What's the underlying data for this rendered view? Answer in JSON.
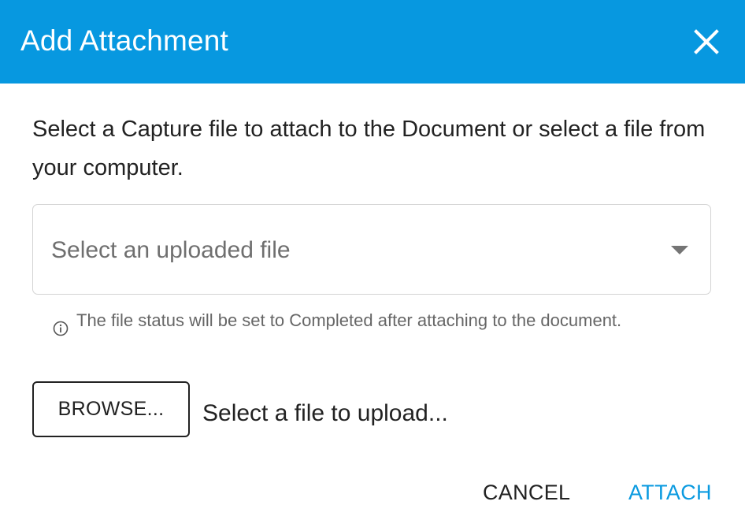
{
  "dialog": {
    "title": "Add Attachment",
    "close_icon": "close-icon"
  },
  "content": {
    "description": "Select a Capture file to attach to the Document or select a file from your computer.",
    "select": {
      "placeholder": "Select an uploaded file",
      "arrow_icon": "dropdown-arrow-icon"
    },
    "helper": {
      "icon": "info-icon",
      "text": "The file status will be set to Completed after attaching to the document."
    },
    "upload": {
      "browse_label": "BROWSE...",
      "status_text": "Select a file to upload..."
    }
  },
  "actions": {
    "cancel_label": "CANCEL",
    "attach_label": "ATTACH"
  },
  "colors": {
    "header_background": "#0798e0",
    "accent": "#0a9ae0",
    "text": "#222222",
    "muted_text": "#666666"
  }
}
